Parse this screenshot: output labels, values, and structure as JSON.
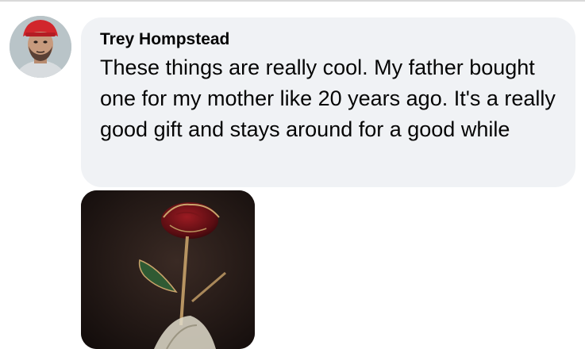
{
  "comment": {
    "author": "Trey Hompstead",
    "text": "These things are really cool. My father bought one for my mother like 20 years ago. It's a really good gift and stays around for a good while",
    "bubble_color": "#f0f2f5",
    "text_color": "#050505",
    "avatar_icon": "user-avatar-photo",
    "attachment_icon": "metal-rose-photo"
  }
}
